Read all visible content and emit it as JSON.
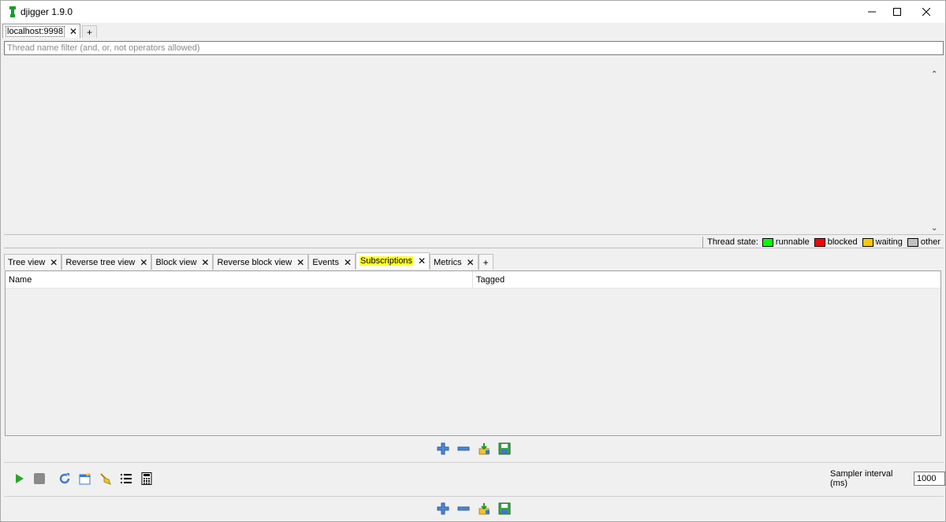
{
  "window": {
    "title": "djigger 1.9.0",
    "min_glyph": "—",
    "max_glyph": "☐",
    "close_glyph": "✕"
  },
  "connections": {
    "tabs": [
      {
        "label": "localhost:9998",
        "close": "✕"
      }
    ],
    "add": "+"
  },
  "filter": {
    "placeholder": "Thread name filter (and, or, not operators allowed)",
    "value": ""
  },
  "thread_panel": {
    "scroll_up": "⌃",
    "scroll_down": "⌄"
  },
  "thread_state": {
    "label": "Thread state:",
    "states": [
      {
        "name": "runnable",
        "color": "#00ff00"
      },
      {
        "name": "blocked",
        "color": "#ff0000"
      },
      {
        "name": "waiting",
        "color": "#ffc800"
      },
      {
        "name": "other",
        "color": "#c0c0c0"
      }
    ]
  },
  "view_tabs": {
    "tabs": [
      {
        "label": "Tree view",
        "close": "✕"
      },
      {
        "label": "Reverse tree view",
        "close": "✕"
      },
      {
        "label": "Block view",
        "close": "✕"
      },
      {
        "label": "Reverse block view",
        "close": "✕"
      },
      {
        "label": "Events",
        "close": "✕"
      },
      {
        "label": "Subscriptions",
        "close": "✕",
        "active": true
      },
      {
        "label": "Metrics",
        "close": "✕"
      }
    ],
    "add": "+"
  },
  "subscriptions_table": {
    "columns": [
      "Name",
      "Tagged"
    ],
    "rows": []
  },
  "icons": {
    "add": "plus-icon",
    "remove": "minus-icon",
    "import": "import-icon",
    "save": "save-icon",
    "play": "play-icon",
    "stop": "stop-icon",
    "refresh": "refresh-icon",
    "edit": "edit-icon",
    "clean": "clean-icon",
    "list": "list-icon",
    "calculator": "calculator-icon"
  },
  "colors": {
    "accent_blue": "#3d78c9",
    "active_tab_highlight": "#ffff2e",
    "play_green": "#2aa52a"
  },
  "sampler": {
    "label": "Sampler interval (ms)",
    "value": "1000"
  }
}
